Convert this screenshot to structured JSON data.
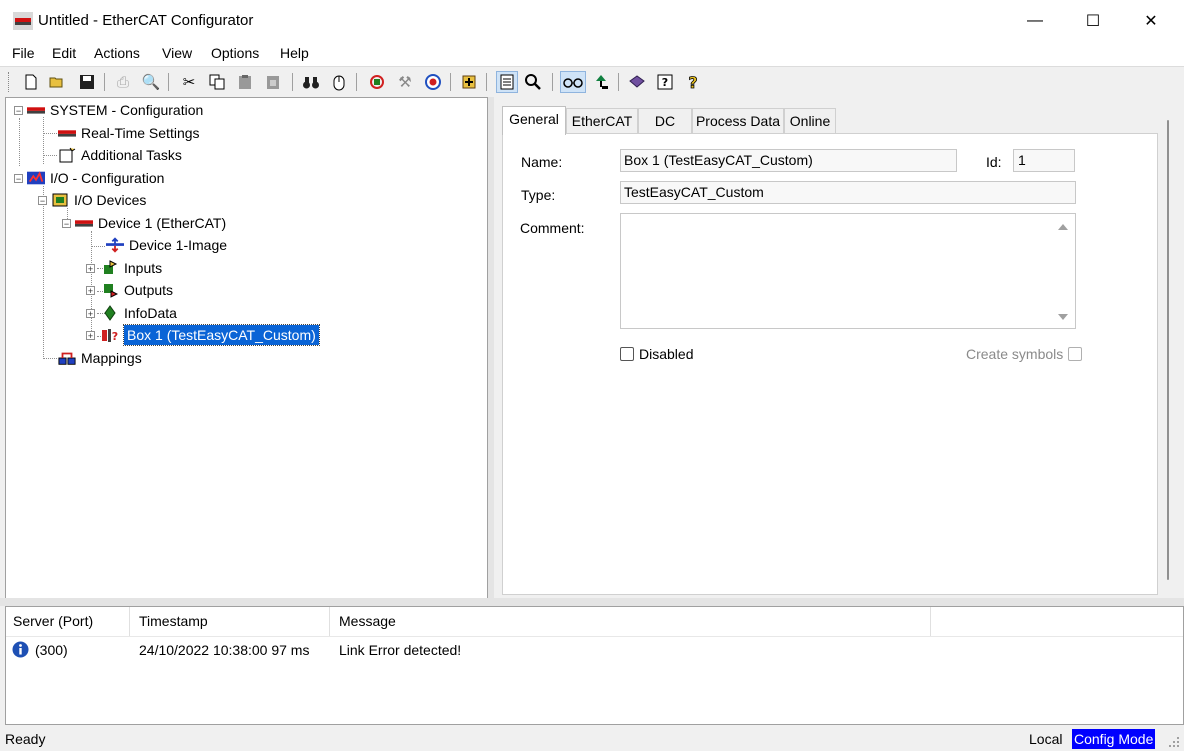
{
  "window": {
    "title": "Untitled - EtherCAT Configurator",
    "minimize_glyph": "—",
    "maximize_glyph": "☐",
    "close_glyph": "✕"
  },
  "menu": [
    "File",
    "Edit",
    "Actions",
    "View",
    "Options",
    "Help"
  ],
  "tree": {
    "items": [
      {
        "label": "SYSTEM - Configuration",
        "icon": "system-icon"
      },
      {
        "label": "Real-Time Settings",
        "icon": "realtime-icon"
      },
      {
        "label": "Additional Tasks",
        "icon": "tasks-icon"
      },
      {
        "label": "I/O - Configuration",
        "icon": "io-config-icon"
      },
      {
        "label": "I/O Devices",
        "icon": "io-devices-icon"
      },
      {
        "label": "Device 1 (EtherCAT)",
        "icon": "ethercat-device-icon"
      },
      {
        "label": "Device 1-Image",
        "icon": "image-icon"
      },
      {
        "label": "Inputs",
        "icon": "inputs-icon"
      },
      {
        "label": "Outputs",
        "icon": "outputs-icon"
      },
      {
        "label": "InfoData",
        "icon": "infodata-icon"
      },
      {
        "label": "Box 1 (TestEasyCAT_Custom)",
        "icon": "box-icon"
      },
      {
        "label": "Mappings",
        "icon": "mappings-icon"
      }
    ]
  },
  "tabs": [
    "General",
    "EtherCAT",
    "DC",
    "Process Data",
    "Online"
  ],
  "general": {
    "name_label": "Name:",
    "name_value": "Box 1 (TestEasyCAT_Custom)",
    "id_label": "Id:",
    "id_value": "1",
    "type_label": "Type:",
    "type_value": "TestEasyCAT_Custom",
    "comment_label": "Comment:",
    "comment_value": "",
    "disabled_label": "Disabled",
    "create_symbols_label": "Create symbols"
  },
  "log": {
    "columns": [
      "Server (Port)",
      "Timestamp",
      "Message"
    ],
    "rows": [
      {
        "server": "(300)",
        "timestamp": "24/10/2022 10:38:00 97 ms",
        "message": "Link Error detected!"
      }
    ]
  },
  "status": {
    "ready": "Ready",
    "local": "Local",
    "mode": "Config Mode"
  },
  "colors": {
    "selection": "#0a64d6",
    "mode_badge": "#0000ff",
    "info_icon": "#1e50b4"
  }
}
